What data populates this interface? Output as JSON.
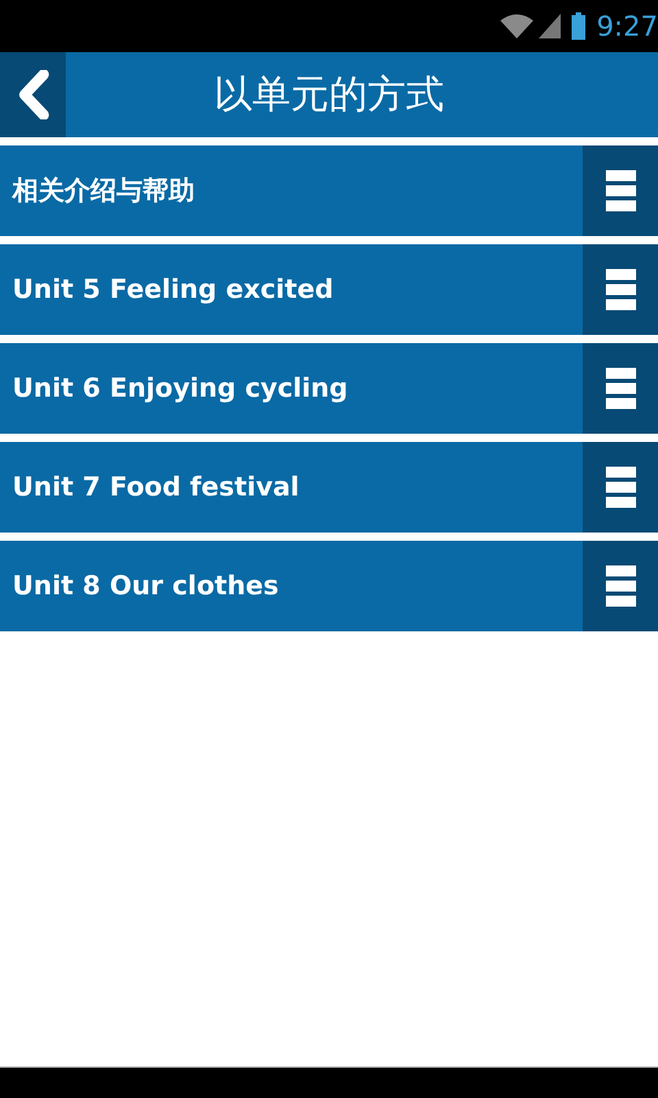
{
  "status_bar": {
    "time": "9:27"
  },
  "header": {
    "title": "以单元的方式"
  },
  "items": [
    {
      "label": "相关介绍与帮助"
    },
    {
      "label": "Unit 5 Feeling excited"
    },
    {
      "label": "Unit 6 Enjoying cycling"
    },
    {
      "label": "Unit 7 Food festival"
    },
    {
      "label": "Unit 8 Our clothes"
    }
  ]
}
